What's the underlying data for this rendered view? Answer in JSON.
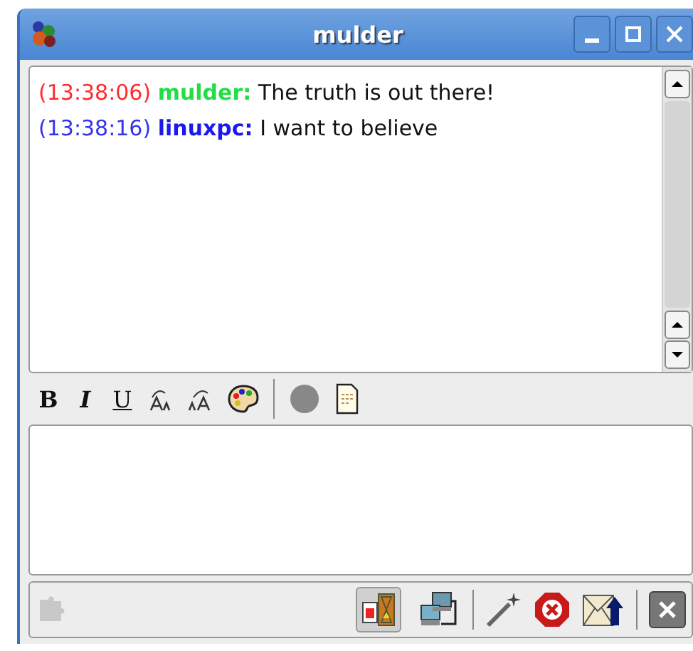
{
  "window": {
    "title": "mulder"
  },
  "messages": [
    {
      "time": "(13:38:06)",
      "sender": "mulder:",
      "text": "The truth is out there!",
      "kind": "received"
    },
    {
      "time": "(13:38:16)",
      "sender": "linuxpc:",
      "text": "I want to believe",
      "kind": "sent"
    }
  ],
  "format_toolbar": [
    {
      "label": "B",
      "kind": "bold"
    },
    {
      "label": "I",
      "kind": "italic"
    },
    {
      "label": "U",
      "kind": "underline"
    }
  ],
  "bottom_toolbar": [
    {
      "kind": "typing",
      "pressed": true
    },
    {
      "kind": "network",
      "pressed": false
    }
  ]
}
